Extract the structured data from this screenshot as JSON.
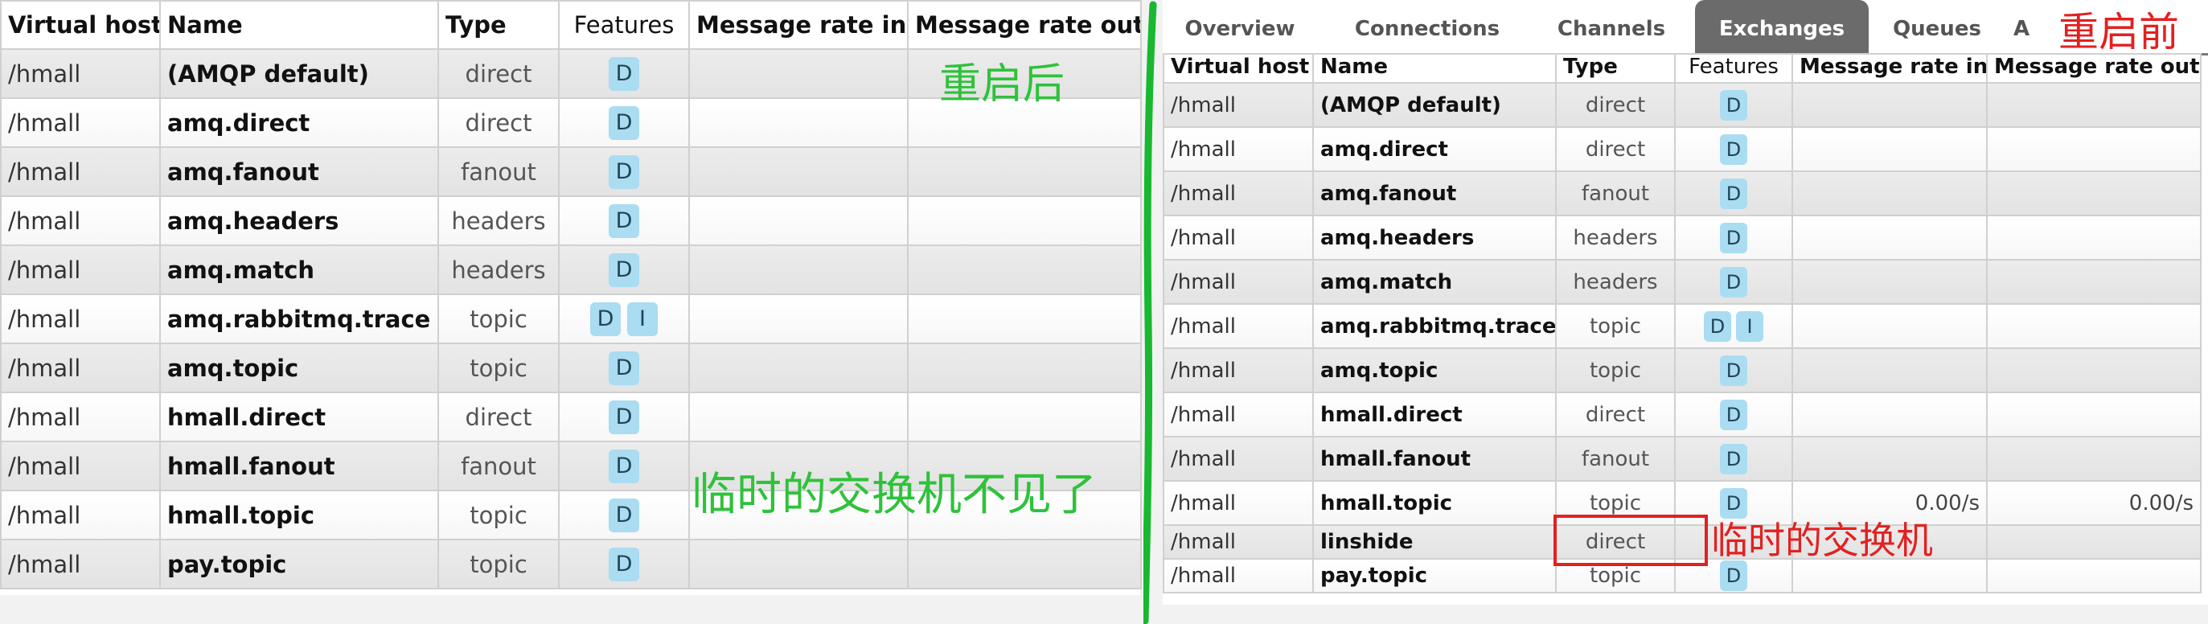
{
  "columns": {
    "vhost": "Virtual host",
    "name": "Name",
    "type": "Type",
    "features": "Features",
    "rate_in": "Message rate in",
    "rate_out": "Message rate out"
  },
  "after_restart": {
    "label": "重启后",
    "note": "临时的交换机不见了",
    "rows": [
      {
        "vhost": "/hmall",
        "name": "(AMQP default)",
        "type": "direct",
        "features": [
          "D"
        ],
        "rate_in": "",
        "rate_out": ""
      },
      {
        "vhost": "/hmall",
        "name": "amq.direct",
        "type": "direct",
        "features": [
          "D"
        ],
        "rate_in": "",
        "rate_out": ""
      },
      {
        "vhost": "/hmall",
        "name": "amq.fanout",
        "type": "fanout",
        "features": [
          "D"
        ],
        "rate_in": "",
        "rate_out": ""
      },
      {
        "vhost": "/hmall",
        "name": "amq.headers",
        "type": "headers",
        "features": [
          "D"
        ],
        "rate_in": "",
        "rate_out": ""
      },
      {
        "vhost": "/hmall",
        "name": "amq.match",
        "type": "headers",
        "features": [
          "D"
        ],
        "rate_in": "",
        "rate_out": ""
      },
      {
        "vhost": "/hmall",
        "name": "amq.rabbitmq.trace",
        "type": "topic",
        "features": [
          "D",
          "I"
        ],
        "rate_in": "",
        "rate_out": ""
      },
      {
        "vhost": "/hmall",
        "name": "amq.topic",
        "type": "topic",
        "features": [
          "D"
        ],
        "rate_in": "",
        "rate_out": ""
      },
      {
        "vhost": "/hmall",
        "name": "hmall.direct",
        "type": "direct",
        "features": [
          "D"
        ],
        "rate_in": "",
        "rate_out": ""
      },
      {
        "vhost": "/hmall",
        "name": "hmall.fanout",
        "type": "fanout",
        "features": [
          "D"
        ],
        "rate_in": "",
        "rate_out": ""
      },
      {
        "vhost": "/hmall",
        "name": "hmall.topic",
        "type": "topic",
        "features": [
          "D"
        ],
        "rate_in": "",
        "rate_out": ""
      },
      {
        "vhost": "/hmall",
        "name": "pay.topic",
        "type": "topic",
        "features": [
          "D"
        ],
        "rate_in": "",
        "rate_out": ""
      }
    ]
  },
  "before_restart": {
    "label": "重启前",
    "note": "临时的交换机",
    "tabs": [
      {
        "label": "Overview",
        "active": false
      },
      {
        "label": "Connections",
        "active": false
      },
      {
        "label": "Channels",
        "active": false
      },
      {
        "label": "Exchanges",
        "active": true
      },
      {
        "label": "Queues",
        "active": false
      },
      {
        "label": "A",
        "active": false
      }
    ],
    "rows": [
      {
        "vhost": "/hmall",
        "name": "(AMQP default)",
        "type": "direct",
        "features": [
          "D"
        ],
        "rate_in": "",
        "rate_out": ""
      },
      {
        "vhost": "/hmall",
        "name": "amq.direct",
        "type": "direct",
        "features": [
          "D"
        ],
        "rate_in": "",
        "rate_out": ""
      },
      {
        "vhost": "/hmall",
        "name": "amq.fanout",
        "type": "fanout",
        "features": [
          "D"
        ],
        "rate_in": "",
        "rate_out": ""
      },
      {
        "vhost": "/hmall",
        "name": "amq.headers",
        "type": "headers",
        "features": [
          "D"
        ],
        "rate_in": "",
        "rate_out": ""
      },
      {
        "vhost": "/hmall",
        "name": "amq.match",
        "type": "headers",
        "features": [
          "D"
        ],
        "rate_in": "",
        "rate_out": ""
      },
      {
        "vhost": "/hmall",
        "name": "amq.rabbitmq.trace",
        "type": "topic",
        "features": [
          "D",
          "I"
        ],
        "rate_in": "",
        "rate_out": ""
      },
      {
        "vhost": "/hmall",
        "name": "amq.topic",
        "type": "topic",
        "features": [
          "D"
        ],
        "rate_in": "",
        "rate_out": ""
      },
      {
        "vhost": "/hmall",
        "name": "hmall.direct",
        "type": "direct",
        "features": [
          "D"
        ],
        "rate_in": "",
        "rate_out": ""
      },
      {
        "vhost": "/hmall",
        "name": "hmall.fanout",
        "type": "fanout",
        "features": [
          "D"
        ],
        "rate_in": "",
        "rate_out": ""
      },
      {
        "vhost": "/hmall",
        "name": "hmall.topic",
        "type": "topic",
        "features": [
          "D"
        ],
        "rate_in": "0.00/s",
        "rate_out": "0.00/s"
      },
      {
        "vhost": "/hmall",
        "name": "linshide",
        "type": "direct",
        "features": [],
        "rate_in": "",
        "rate_out": ""
      },
      {
        "vhost": "/hmall",
        "name": "pay.topic",
        "type": "topic",
        "features": [
          "D"
        ],
        "rate_in": "",
        "rate_out": ""
      }
    ]
  },
  "colors": {
    "annotation_green": "#2ec23a",
    "annotation_red": "#e32020",
    "feature_badge": "#aadcf2",
    "active_tab": "#6b6b6b"
  }
}
